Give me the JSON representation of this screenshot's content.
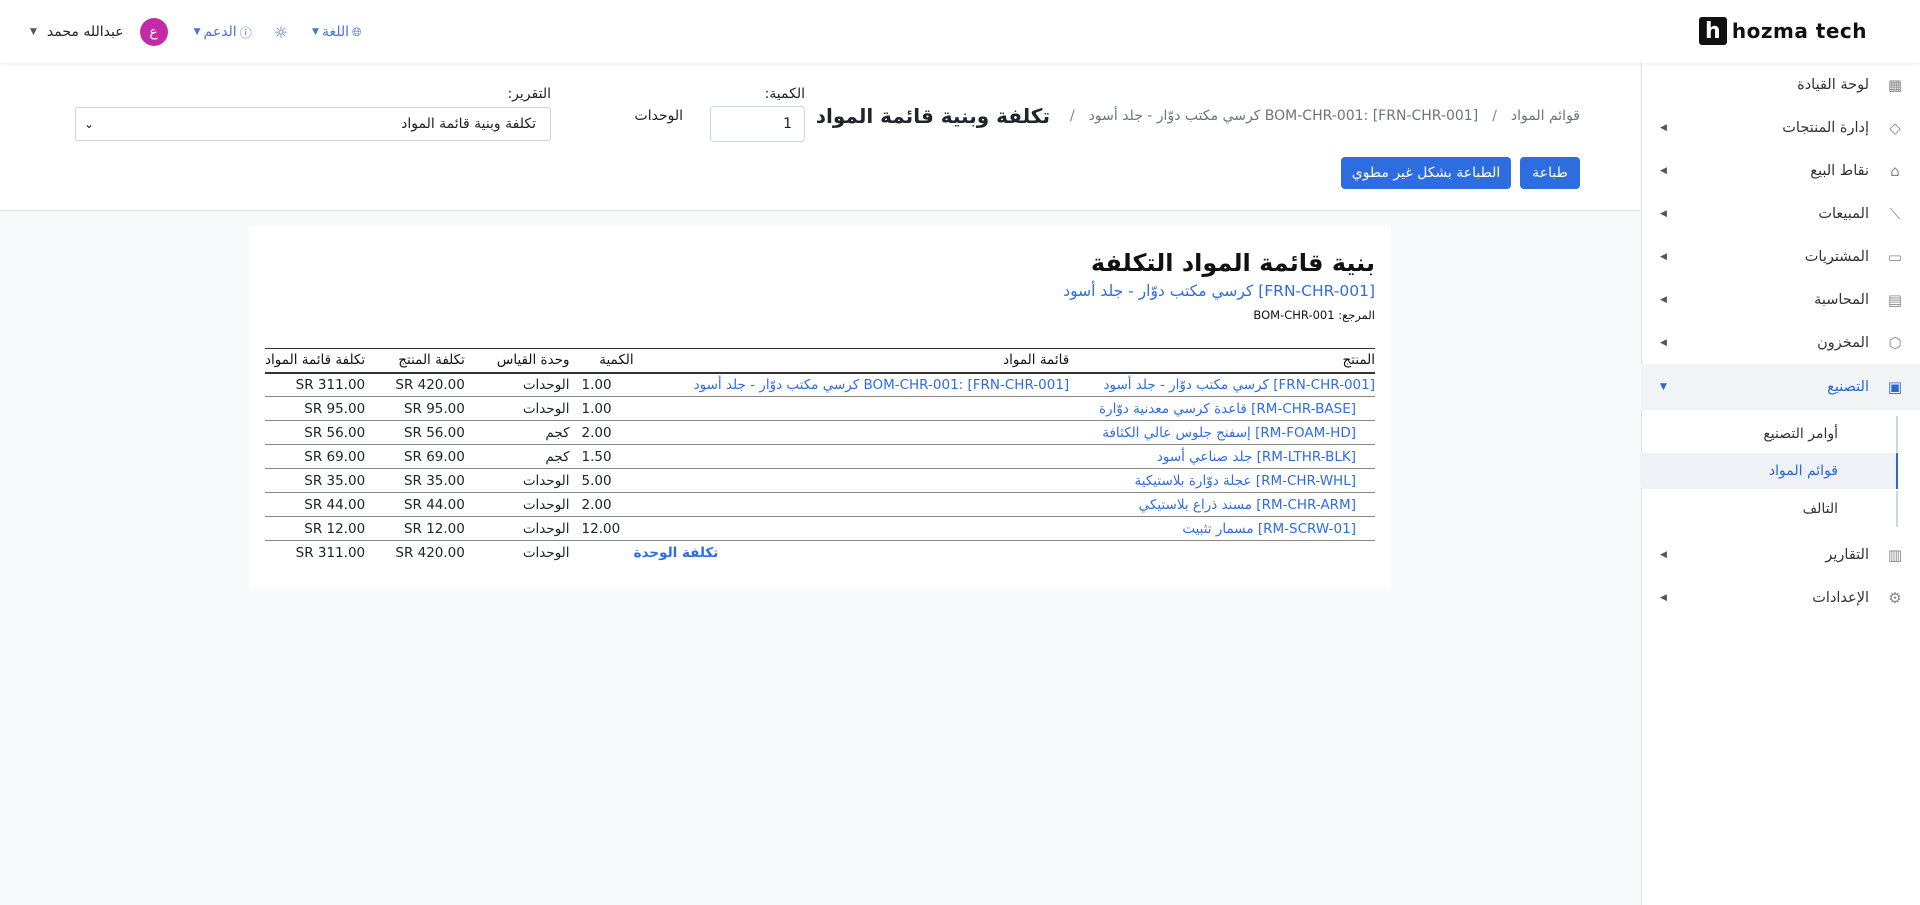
{
  "brand": {
    "mark": "h",
    "name": "hozma tech"
  },
  "topbar": {
    "user_name": "عبدالله محمد",
    "avatar_letter": "ع",
    "support_label": "الدعم",
    "language_label": "اللغة"
  },
  "sidebar": {
    "items": [
      {
        "label": "لوحة القيادة",
        "icon": "dashboard-icon"
      },
      {
        "label": "إدارة المنتجات",
        "icon": "tag-icon"
      },
      {
        "label": "نقاط البيع",
        "icon": "store-icon"
      },
      {
        "label": "المبيعات",
        "icon": "chart-line-icon"
      },
      {
        "label": "المشتريات",
        "icon": "wallet-icon"
      },
      {
        "label": "المحاسبة",
        "icon": "calculator-icon"
      },
      {
        "label": "المخزون",
        "icon": "box-icon"
      },
      {
        "label": "التصنيع",
        "icon": "factory-icon"
      },
      {
        "label": "التقارير",
        "icon": "report-icon"
      },
      {
        "label": "الإعدادات",
        "icon": "gear-icon"
      }
    ],
    "submenu": [
      {
        "label": "أوامر التصنيع"
      },
      {
        "label": "قوائم المواد"
      },
      {
        "label": "التالف"
      }
    ]
  },
  "header": {
    "breadcrumb_root": "قوائم المواد",
    "breadcrumb_item": "BOM-CHR-001: [FRN-CHR-001] كرسي مكتب دوّار - جلد أسود",
    "title": "تكلفة وبنية قائمة المواد",
    "print_label": "طباعة",
    "print_unfolded_label": "الطباعة بشكل غير مطوي",
    "quantity_label": "الكمية:",
    "quantity_value": "1",
    "units_label": "الوحدات",
    "report_label": "التقرير:",
    "report_value": "تكلفة وبنية قائمة المواد"
  },
  "report": {
    "title": "بنية قائمة المواد التكلفة",
    "product_link": "[FRN-CHR-001] كرسي مكتب دوّار - جلد أسود",
    "reference": "المرجع: BOM-CHR-001",
    "columns": {
      "product": "المنتج",
      "bom": "قائمة المواد",
      "qty": "الكمية",
      "uom": "وحدة القياس",
      "product_cost": "تكلفة المنتج",
      "bom_cost": "تكلفة قائمة المواد"
    },
    "rows": [
      {
        "product": "[FRN-CHR-001] كرسي مكتب دوّار - جلد أسود",
        "bom": "BOM-CHR-001: [FRN-CHR-001] كرسي مكتب دوّار - جلد أسود",
        "qty": "1.00",
        "uom": "الوحدات",
        "product_cost": "SR 420.00",
        "bom_cost": "SR 311.00"
      },
      {
        "product": "[RM-CHR-BASE] قاعدة كرسي معدنية دوّارة",
        "bom": "",
        "qty": "1.00",
        "uom": "الوحدات",
        "product_cost": "SR 95.00",
        "bom_cost": "SR 95.00"
      },
      {
        "product": "[RM-FOAM-HD] إسفنج جلوس عالي الكثافة",
        "bom": "",
        "qty": "2.00",
        "uom": "كجم",
        "product_cost": "SR 56.00",
        "bom_cost": "SR 56.00"
      },
      {
        "product": "[RM-LTHR-BLK] جلد صناعي أسود",
        "bom": "",
        "qty": "1.50",
        "uom": "كجم",
        "product_cost": "SR 69.00",
        "bom_cost": "SR 69.00"
      },
      {
        "product": "[RM-CHR-WHL] عجلة دوّارة بلاستيكية",
        "bom": "",
        "qty": "5.00",
        "uom": "الوحدات",
        "product_cost": "SR 35.00",
        "bom_cost": "SR 35.00"
      },
      {
        "product": "[RM-CHR-ARM] مسند ذراع بلاستيكي",
        "bom": "",
        "qty": "2.00",
        "uom": "الوحدات",
        "product_cost": "SR 44.00",
        "bom_cost": "SR 44.00"
      },
      {
        "product": "[RM-SCRW-01] مسمار تثبيت",
        "bom": "",
        "qty": "12.00",
        "uom": "الوحدات",
        "product_cost": "SR 12.00",
        "bom_cost": "SR 12.00"
      }
    ],
    "total": {
      "label": "تكلفة الوحدة",
      "uom": "الوحدات",
      "product_cost": "SR 420.00",
      "bom_cost": "SR 311.00"
    }
  }
}
